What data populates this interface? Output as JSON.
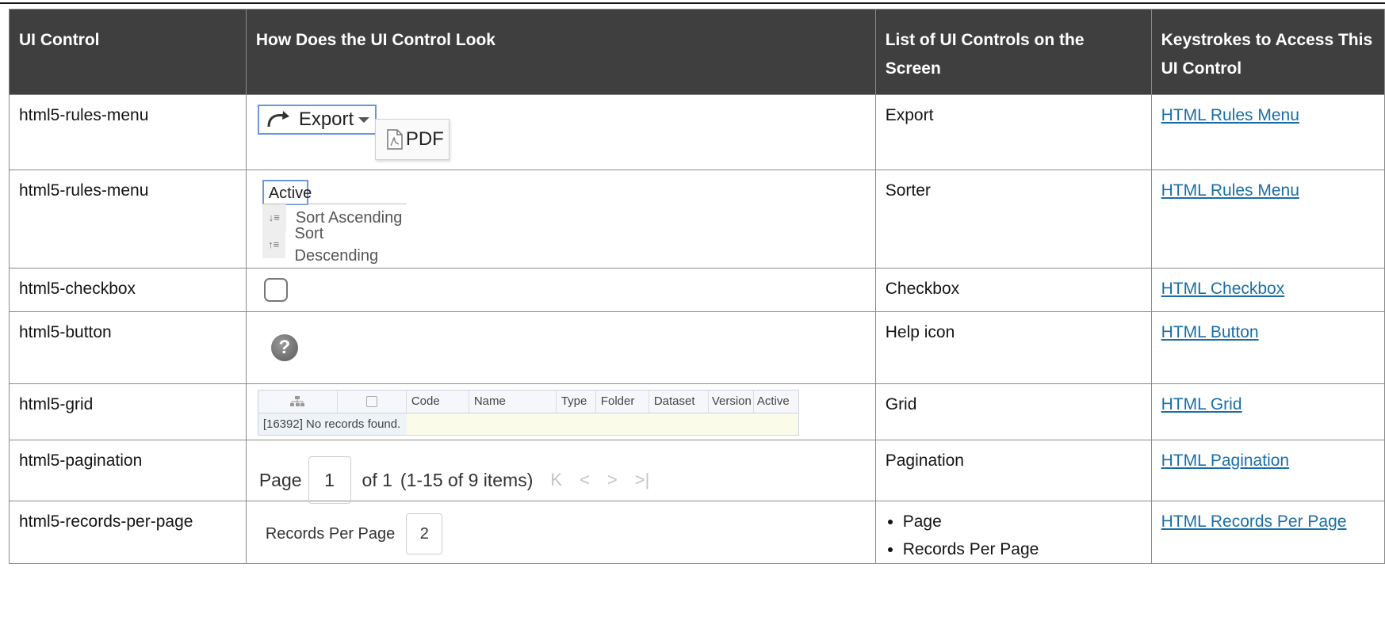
{
  "table": {
    "headers": [
      "UI Control",
      "How Does the UI Control Look",
      "List of UI Controls on the Screen",
      "Keystrokes to Access This UI Control"
    ],
    "rows": [
      {
        "control": "html5-rules-menu",
        "list": "Export",
        "link": "HTML Rules Menu"
      },
      {
        "control": "html5-rules-menu",
        "list": "Sorter",
        "link": "HTML Rules Menu"
      },
      {
        "control": "html5-checkbox",
        "list": "Checkbox",
        "link": "HTML Checkbox"
      },
      {
        "control": "html5-button",
        "list": "Help icon",
        "link": "HTML Button"
      },
      {
        "control": "html5-grid",
        "list": "Grid",
        "link": "HTML Grid"
      },
      {
        "control": "html5-pagination",
        "list": "Pagination",
        "link": "HTML Pagination"
      },
      {
        "control": "html5-records-per-page",
        "list_items": [
          "Page",
          "Records Per Page"
        ],
        "link": "HTML Records Per Page"
      }
    ]
  },
  "samples": {
    "export": {
      "label": "Export",
      "menu_item": "PDF",
      "icon": "export-arrow-icon",
      "pdf_icon": "pdf-icon"
    },
    "sorter": {
      "field": "Active",
      "asc": "Sort Ascending",
      "desc": "Sort Descending"
    },
    "help": {
      "glyph": "?"
    },
    "grid": {
      "columns": [
        "Code",
        "Name",
        "Type",
        "Folder",
        "Dataset",
        "Version",
        "Active"
      ],
      "message": "[16392] No records found."
    },
    "pagination": {
      "page_label": "Page",
      "page": "1",
      "of": "of 1",
      "range": "(1-15 of  9 items)"
    },
    "records": {
      "label": "Records Per Page",
      "value": "2"
    }
  },
  "colors": {
    "header_bg": "#3f3f3f",
    "link": "#1a6ea8",
    "focus": "#6b95e0"
  }
}
